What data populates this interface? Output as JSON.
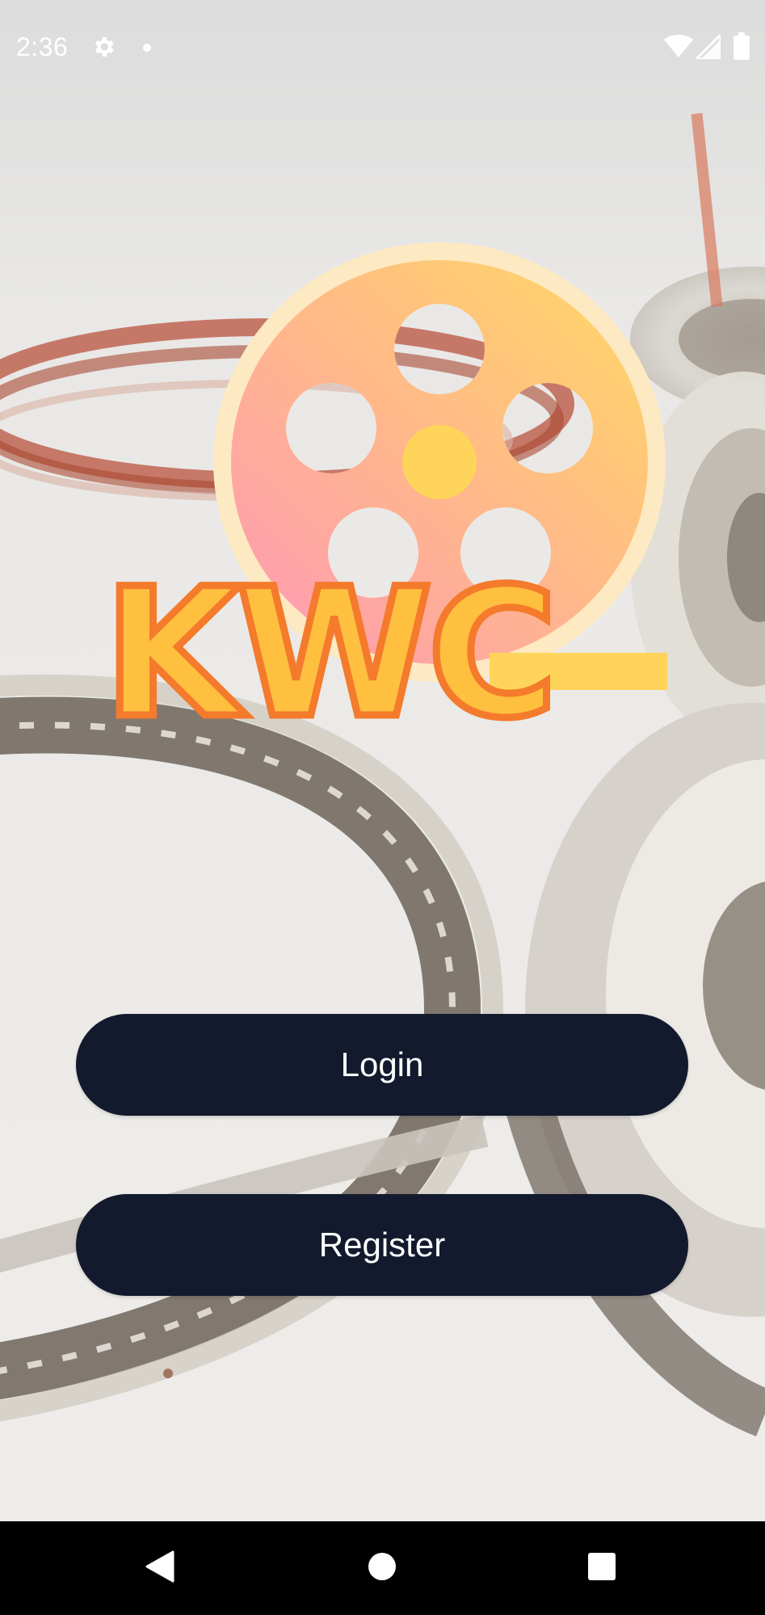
{
  "status_bar": {
    "time": "2:36",
    "icons": [
      "settings-icon",
      "notification-dot-icon",
      "wifi-icon",
      "signal-icon",
      "battery-icon"
    ]
  },
  "logo": {
    "text": "KWC",
    "colors": {
      "reel_gradient_start": "#ff97b8",
      "reel_gradient_end": "#ffd964",
      "reel_border": "#fde9c2",
      "letter_fill": "#ffbf3f",
      "letter_outline": "#f47a2c"
    }
  },
  "buttons": {
    "login_label": "Login",
    "register_label": "Register"
  },
  "theme": {
    "button_bg": "#131a2d",
    "button_text": "#ffffff"
  },
  "nav_bar": {
    "icons": [
      "back-icon",
      "home-icon",
      "recents-icon"
    ]
  }
}
